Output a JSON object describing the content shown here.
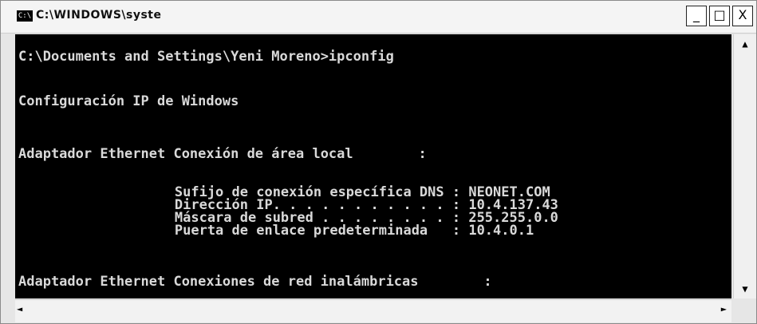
{
  "window": {
    "title": "C:\\WINDOWS\\syste",
    "app_icon": "C:\\",
    "buttons": {
      "minimize": "_",
      "maximize": "□",
      "close": "X"
    }
  },
  "console": {
    "lines": [
      "C:\\Documents and Settings\\Yeni Moreno>ipconfig",
      "Configuración IP de Windows",
      "Adaptador Ethernet Conexión de área local        :",
      "        Sufijo de conexión específica DNS : NEONET.COM",
      "        Dirección IP. . . . . . . . . . . : 10.4.137.43",
      "        Máscara de subred . . . . . . . . : 255.255.0.0",
      "        Puerta de enlace predeterminada   : 10.4.0.1",
      "Adaptador Ethernet Conexiones de red inalámbricas        :"
    ]
  },
  "scrollbars": {
    "up_arrow": "▲",
    "down_arrow": "▼",
    "left_arrow": "◄",
    "right_arrow": "►"
  }
}
